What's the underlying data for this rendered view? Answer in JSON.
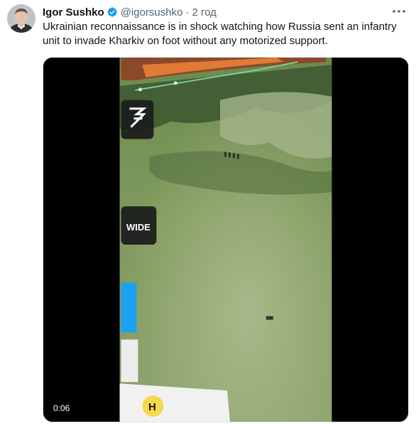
{
  "tweet": {
    "author_name": "Igor Sushko",
    "handle": "@igorsushko",
    "separator": "·",
    "timestamp": "2 год",
    "text": "Ukrainian reconnaissance is in shock watching how Russia sent an infantry unit to invade Kharkiv on foot without any motorized support."
  },
  "media": {
    "type": "video",
    "duration": "0:06",
    "overlay_labels": {
      "wide": "WIDE",
      "h": "H"
    }
  },
  "colors": {
    "verified": "#1d9bf0",
    "text": "#0f1419",
    "secondary": "#536471"
  },
  "icons": {
    "verified": "verified-badge-icon",
    "more": "more-options-icon"
  }
}
